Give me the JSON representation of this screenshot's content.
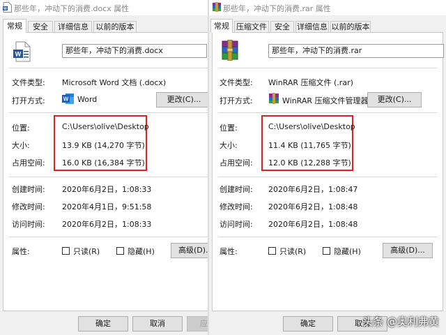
{
  "docx_dialog": {
    "title": "那些年，冲动下的消费.docx 属性",
    "tabs": [
      "常规",
      "安全",
      "详细信息",
      "以前的版本"
    ],
    "filename": "那些年，冲动下的消费.docx",
    "labels": {
      "file_type": "文件类型:",
      "opens_with": "打开方式:",
      "location": "位置:",
      "size": "大小:",
      "size_on_disk": "占用空间:",
      "created": "创建时间:",
      "modified": "修改时间:",
      "accessed": "访问时间:",
      "attributes": "属性:"
    },
    "values": {
      "file_type": "Microsoft Word 文档 (.docx)",
      "opens_with": "Word",
      "location": "C:\\Users\\olive\\Desktop",
      "size": "13.9 KB (14,270 字节)",
      "size_on_disk": "16.0 KB (16,384 字节)",
      "created": "2020年6月2日，1:08:33",
      "modified": "2020年4月1日，9:51:58",
      "accessed": "2020年6月2日，1:08:33"
    },
    "change_button": "更改(C)...",
    "readonly_label": "只读(R)",
    "hidden_label": "隐藏(H)",
    "advanced_button": "高级(D)...",
    "ok_button": "确定",
    "cancel_button": "取消",
    "apply_button": "应用(A)"
  },
  "rar_dialog": {
    "title": "那些年，冲动下的消费.rar 属性",
    "tabs": [
      "常规",
      "压缩文件",
      "安全",
      "详细信息",
      "以前的版本"
    ],
    "filename": "那些年，冲动下的消费.rar",
    "labels": {
      "file_type": "文件类型:",
      "opens_with": "打开方式:",
      "location": "位置:",
      "size": "大小:",
      "size_on_disk": "占用空间:",
      "created": "创建时间:",
      "modified": "修改时间:",
      "accessed": "访问时间:",
      "attributes": "属性:"
    },
    "values": {
      "file_type": "WinRAR 压缩文件 (.rar)",
      "opens_with": "WinRAR 压缩文件管理器",
      "location": "C:\\Users\\olive\\Desktop",
      "size": "11.4 KB (11,765 字节)",
      "size_on_disk": "12.0 KB (12,288 字节)",
      "created": "2020年6月2日，1:08:47",
      "modified": "2020年6月2日，1:08:48",
      "accessed": "2020年6月2日，1:08:48"
    },
    "change_button": "更改(C)...",
    "readonly_label": "只读(R)",
    "hidden_label": "隐藏(H)",
    "advanced_button": "高级(D)...",
    "ok_button": "确定",
    "cancel_button": "取消"
  },
  "watermark": "头条 @奥利弗黄",
  "colors": {
    "highlight": "#e0201b",
    "word_blue": "#2b579a",
    "panel": "#ffffff",
    "window": "#f0f0f0"
  },
  "icons": [
    "word-document-icon",
    "winrar-archive-icon"
  ]
}
